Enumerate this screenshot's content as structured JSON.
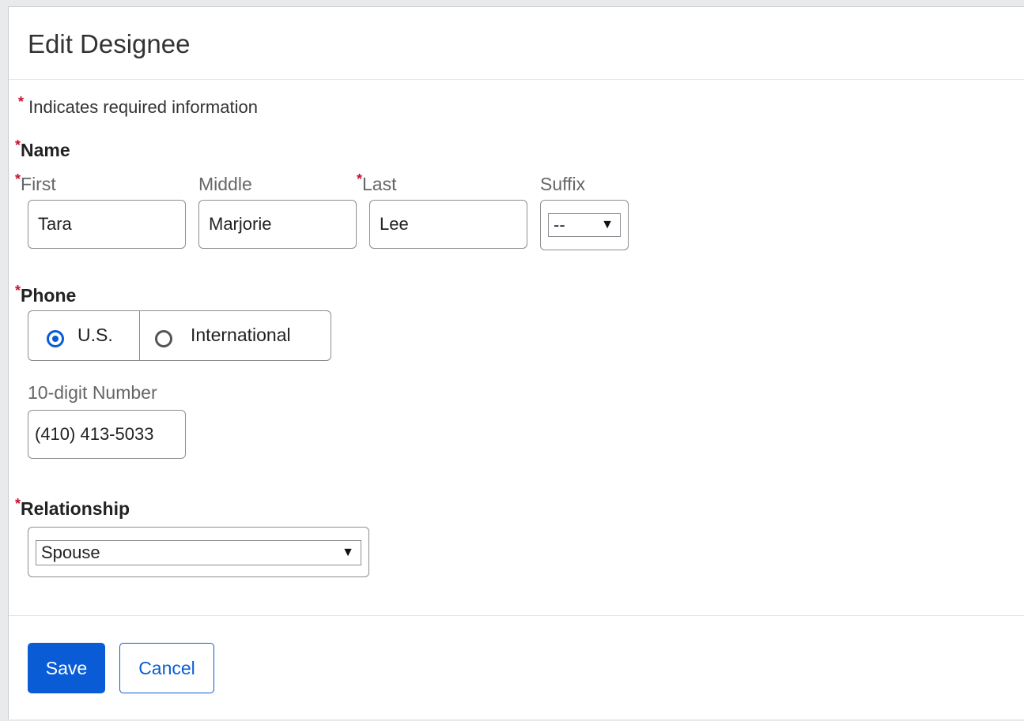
{
  "dialog": {
    "title": "Edit Designee",
    "required_note": "Indicates required information",
    "required_marker": "*"
  },
  "name_section": {
    "label": "Name",
    "first": {
      "label": "First",
      "value": "Tara"
    },
    "middle": {
      "label": "Middle",
      "value": "Marjorie"
    },
    "last": {
      "label": "Last",
      "value": "Lee"
    },
    "suffix": {
      "label": "Suffix",
      "selected": "--"
    }
  },
  "phone_section": {
    "label": "Phone",
    "options": [
      {
        "label": "U.S.",
        "checked": true
      },
      {
        "label": "International",
        "checked": false
      }
    ],
    "number": {
      "label": "10-digit Number",
      "value": "(410) 413-5033"
    }
  },
  "relationship_section": {
    "label": "Relationship",
    "selected": "Spouse"
  },
  "buttons": {
    "save_label": "Save",
    "cancel_label": "Cancel"
  },
  "colors": {
    "primary": "#0a5cd6",
    "required": "#c8102e"
  },
  "icons": {
    "dropdown_arrow": "▼"
  }
}
